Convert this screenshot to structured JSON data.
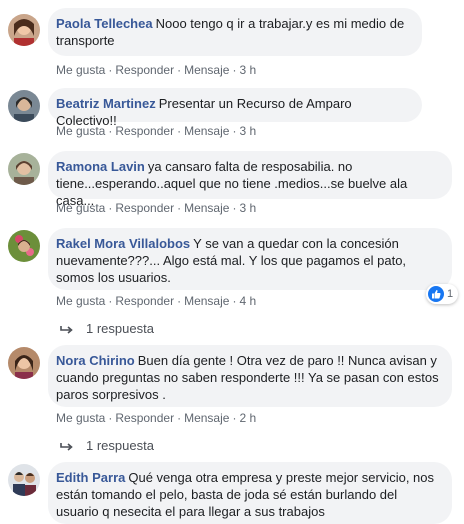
{
  "comments": [
    {
      "author": "Paola Tellechea",
      "text": "Nooo tengo q ir a trabajar.y es mi medio de transporte",
      "actions": {
        "like": "Me gusta",
        "reply": "Responder",
        "message": "Mensaje",
        "time": "3 h"
      }
    },
    {
      "author": "Beatriz Martinez",
      "text": "Presentar un Recurso de Amparo Colectivo!!",
      "actions": {
        "like": "Me gusta",
        "reply": "Responder",
        "message": "Mensaje",
        "time": "3 h"
      }
    },
    {
      "author": "Ramona Lavin",
      "text": "ya cansaro falta de resposabilia. no tiene...esperando..aquel que no tiene .medios...se buelve ala casa...",
      "actions": {
        "like": "Me gusta",
        "reply": "Responder",
        "message": "Mensaje",
        "time": "3 h"
      }
    },
    {
      "author": "Rakel Mora Villalobos",
      "text": "Y se van a quedar con la concesión nuevamente???... Algo está mal. Y los que pagamos el pato, somos los usuarios.",
      "actions": {
        "like": "Me gusta",
        "reply": "Responder",
        "message": "Mensaje",
        "time": "4 h"
      },
      "reaction_count": "1",
      "replies": "1 respuesta"
    },
    {
      "author": "Nora Chirino",
      "text": "Buen día gente ! Otra vez de paro !! Nunca avisan y cuando preguntas no saben responderte !!! Ya se pasan con estos paros sorpresivos .",
      "actions": {
        "like": "Me gusta",
        "reply": "Responder",
        "message": "Mensaje",
        "time": "2 h"
      },
      "replies": "1 respuesta"
    },
    {
      "author": "Edith Parra",
      "text": "Qué venga otra empresa y preste mejor servicio, nos están tomando el pelo, basta de joda sé están burlando del usuario q nesecita el para llegar a sus trabajos"
    }
  ],
  "colors": {
    "author": "#385898",
    "bubble": "#f2f3f5",
    "meta": "#606770",
    "like": "#1877f2"
  }
}
